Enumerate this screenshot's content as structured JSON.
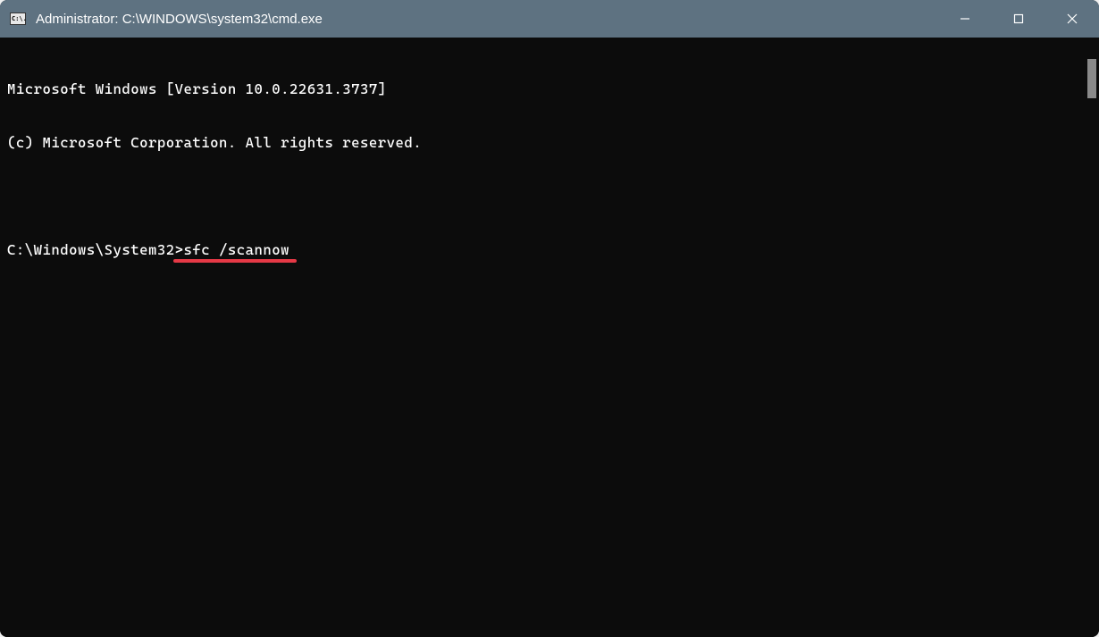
{
  "window": {
    "title": "Administrator: C:\\WINDOWS\\system32\\cmd.exe",
    "icon_label": "C:\\."
  },
  "terminal": {
    "line1": "Microsoft Windows [Version 10.0.22631.3737]",
    "line2": "(c) Microsoft Corporation. All rights reserved.",
    "prompt": "C:\\Windows\\System32>",
    "command": "sfc /scannow"
  },
  "annotation": {
    "underline_color": "#e63946"
  },
  "controls": {
    "minimize": "minimize",
    "maximize": "maximize",
    "close": "close"
  }
}
